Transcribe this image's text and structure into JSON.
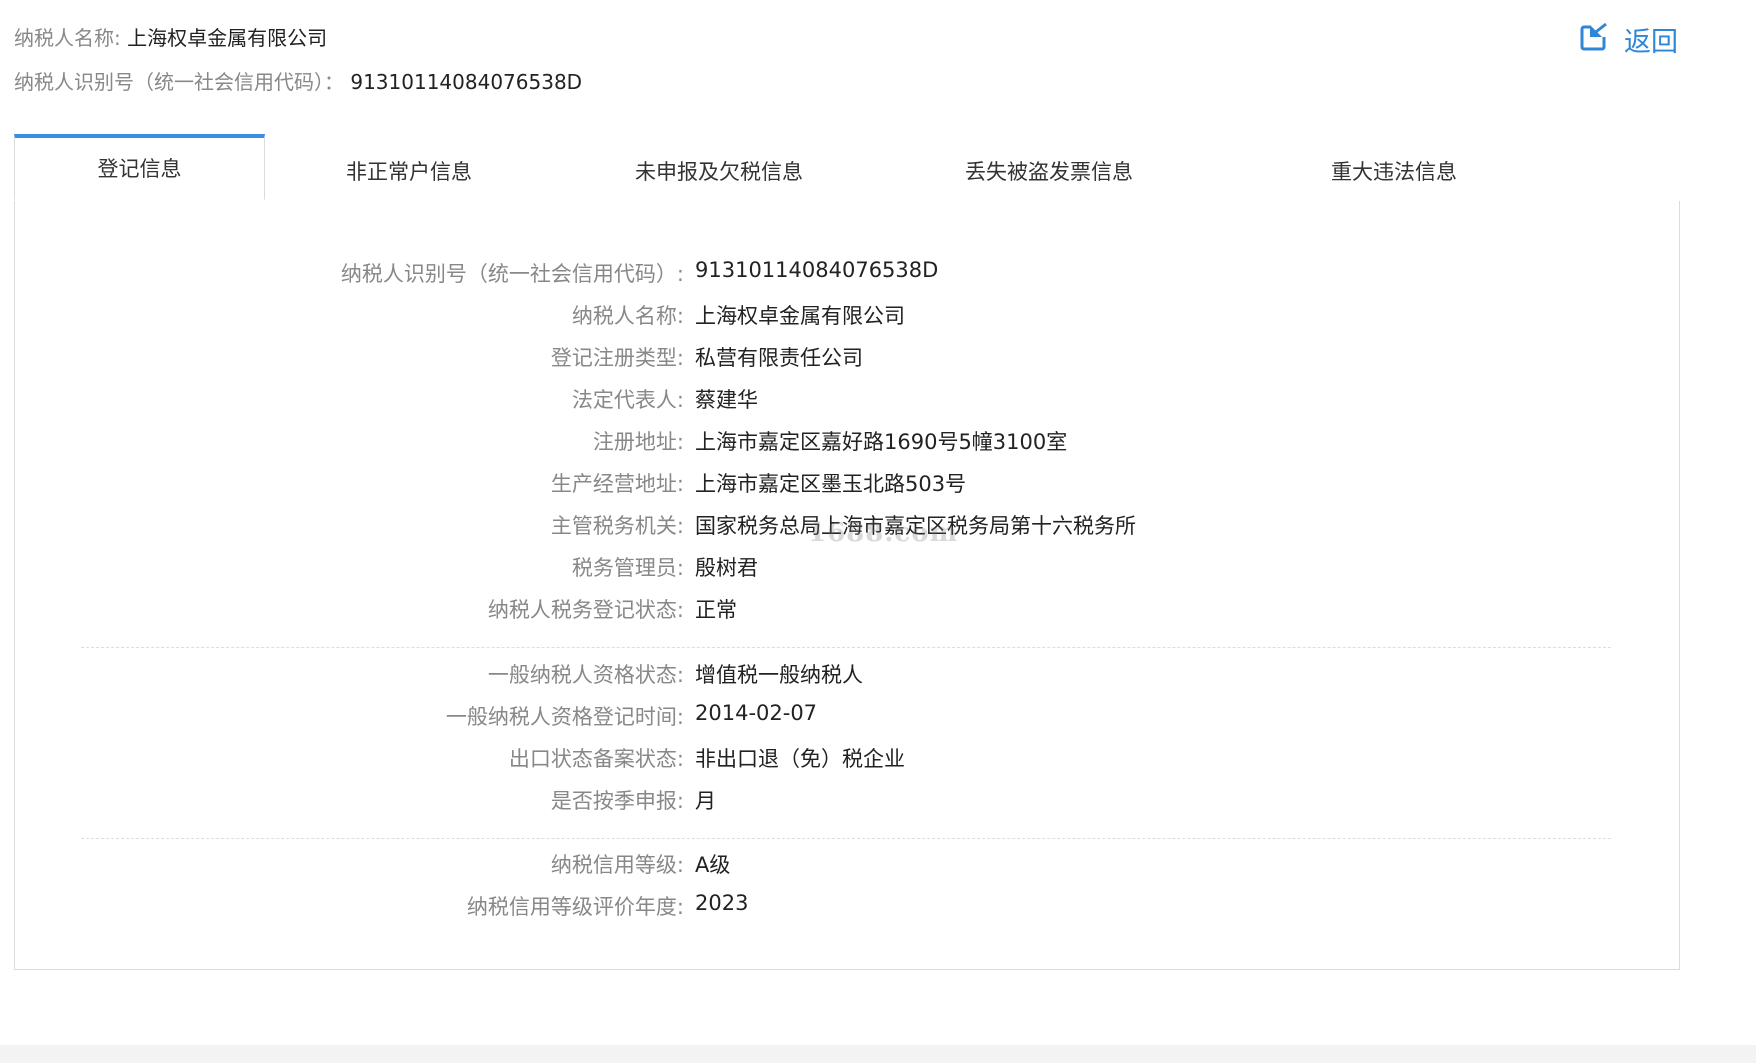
{
  "header": {
    "name_label": "纳税人名称:",
    "name_value": "上海权卓金属有限公司",
    "id_label": "纳税人识别号（统一社会信用代码）：",
    "id_value": "91310114084076538D",
    "back_label": "返回"
  },
  "tabs": [
    {
      "label": "登记信息",
      "active": true
    },
    {
      "label": "非正常户信息",
      "active": false
    },
    {
      "label": "未申报及欠税信息",
      "active": false
    },
    {
      "label": "丢失被盗发票信息",
      "active": false
    },
    {
      "label": "重大违法信息",
      "active": false
    }
  ],
  "details": {
    "group1": [
      {
        "label": "纳税人识别号（统一社会信用代码）:",
        "value": "91310114084076538D"
      },
      {
        "label": "纳税人名称:",
        "value": "上海权卓金属有限公司"
      },
      {
        "label": "登记注册类型:",
        "value": "私营有限责任公司"
      },
      {
        "label": "法定代表人:",
        "value": "蔡建华"
      },
      {
        "label": "注册地址:",
        "value": "上海市嘉定区嘉好路1690号5幢3100室"
      },
      {
        "label": "生产经营地址:",
        "value": "上海市嘉定区墨玉北路503号"
      },
      {
        "label": "主管税务机关:",
        "value": "国家税务总局上海市嘉定区税务局第十六税务所"
      },
      {
        "label": "税务管理员:",
        "value": "殷树君"
      },
      {
        "label": "纳税人税务登记状态:",
        "value": "正常"
      }
    ],
    "group2": [
      {
        "label": "一般纳税人资格状态:",
        "value": "增值税一般纳税人"
      },
      {
        "label": "一般纳税人资格登记时间:",
        "value": "2014-02-07"
      },
      {
        "label": "出口状态备案状态:",
        "value": "非出口退（免）税企业"
      },
      {
        "label": "是否按季申报:",
        "value": "月"
      }
    ],
    "group3": [
      {
        "label": "纳税信用等级:",
        "value": "A级"
      },
      {
        "label": "纳税信用等级评价年度:",
        "value": "2023"
      }
    ]
  },
  "watermark": "1688.com",
  "colors": {
    "accent": "#3b8fe0",
    "link": "#2f86d6",
    "label": "#888888",
    "border": "#dcdcdc"
  },
  "icons": {
    "back": "back-arrow-icon"
  }
}
